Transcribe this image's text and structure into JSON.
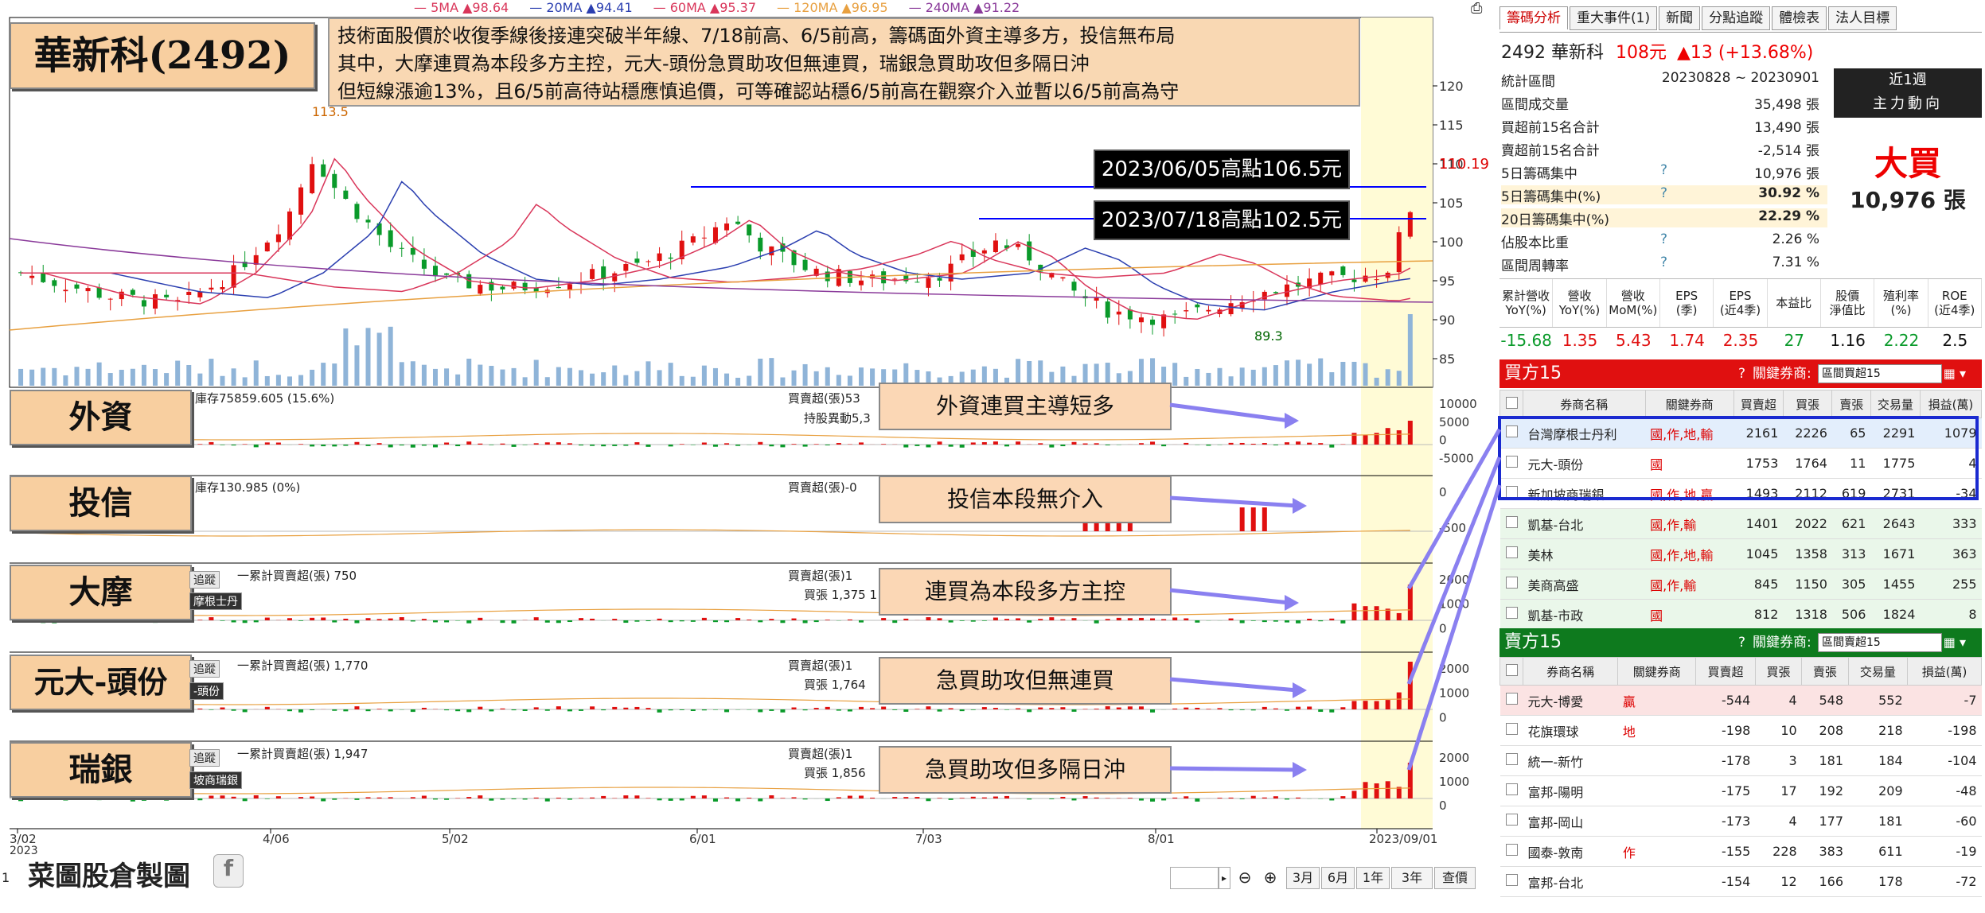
{
  "ma_legend": [
    {
      "label": "5MA ▲98.64",
      "color": "#d9365a"
    },
    {
      "label": "20MA ▲94.41",
      "color": "#2b3fb0"
    },
    {
      "label": "60MA ▲95.37",
      "color": "#d9365a"
    },
    {
      "label": "120MA ▲96.95",
      "color": "#e8a040"
    },
    {
      "label": "240MA ▲91.22",
      "color": "#8a3a9a"
    }
  ],
  "title": "華新科(2492)",
  "note_lines": [
    "技術面股價於收復季線後接連突破半年線、7/18前高、6/5前高，籌碼面外資主導多方，投信無布局",
    "其中，大摩連買為本段多方主控，元大-頭份急買助攻但無連買，瑞銀急買助攻但多隔日沖",
    "但短線漲逾13%，且6/5前高待站穩應慎追價，可等確認站穩6/5前高在觀察介入並暫以6/5前高為守"
  ],
  "price_high_label": "113.5",
  "price_low_label": "89.3",
  "current_price_label": "110.19",
  "price_box_1": "2023/06/05高點106.5元",
  "price_box_2": "2023/07/18高點102.5元",
  "y_ticks": [
    "120",
    "115",
    "110",
    "105",
    "100",
    "95",
    "90",
    "85"
  ],
  "panels": [
    {
      "name": "外資",
      "info1": "庫存75859.605 (15.6%)",
      "info2": "買賣超(張)53",
      "info3": "持股異動5,3",
      "callout": "外資連買主導短多",
      "ticks": [
        "10000",
        "5000",
        "0",
        "-5000"
      ]
    },
    {
      "name": "投信",
      "info1": "庫存130.985 (0%)",
      "info2": "買賣超(張)-0",
      "info3": "",
      "callout": "投信本段無介入",
      "ticks": [
        "0",
        "-500"
      ]
    },
    {
      "name": "大摩",
      "info1": "一累計買賣超(張) 750",
      "info2": "買賣超(張)1",
      "info3": "買張 1,375 1",
      "callout": "連買為本段多方主控",
      "ticks": [
        "2000",
        "1000",
        "0"
      ],
      "btn1": "追蹤",
      "btn2": "摩根士丹"
    },
    {
      "name": "元大-頭份",
      "info1": "一累計買賣超(張) 1,770",
      "info2": "買賣超(張)1",
      "info3": "買張 1,764",
      "callout": "急買助攻但無連買",
      "ticks": [
        "2000",
        "1000",
        "0"
      ],
      "btn1": "追蹤",
      "btn2": "-頭份"
    },
    {
      "name": "瑞銀",
      "info1": "一累計買賣超(張) 1,947",
      "info2": "買賣超(張)1",
      "info3": "買張 1,856",
      "callout": "急買助攻但多隔日沖",
      "ticks": [
        "2000",
        "1000",
        "0"
      ],
      "btn1": "追蹤",
      "btn2": "坡商瑞銀"
    }
  ],
  "x_labels": [
    "3/02",
    "4/06",
    "5/02",
    "6/01",
    "7/03",
    "8/01",
    "2023/09/01"
  ],
  "x_year": "2023",
  "footer_brand": "菜圖股倉製圖",
  "toolbar": [
    "3月",
    "6月",
    "1年",
    "3年",
    "查價"
  ],
  "page_indicator": "1",
  "right": {
    "tabs": [
      "籌碼分析",
      "重大事件(1)",
      "新聞",
      "分點追蹤",
      "體檢表",
      "法人目標"
    ],
    "stock": "2492 華新科",
    "price": "108元",
    "change": "▲13 (+13.68%)",
    "period_label": "近1週",
    "trend_label": "主力動向",
    "big_label": "大買",
    "big_value": "10,976 張",
    "stats": [
      {
        "label": "統計區間",
        "q": "",
        "value": "20230828 ~ 20230901"
      },
      {
        "label": "區間成交量",
        "q": "",
        "value": "35,498 張"
      },
      {
        "label": "買超前15名合計",
        "q": "",
        "value": "13,490 張"
      },
      {
        "label": "賣超前15名合計",
        "q": "",
        "value": "-2,514 張"
      },
      {
        "label": "5日籌碼集中",
        "q": "?",
        "value": "10,976 張"
      },
      {
        "label": "5日籌碼集中(%)",
        "q": "?",
        "value": "30.92 %"
      },
      {
        "label": "20日籌碼集中(%)",
        "q": "",
        "value": "22.29 %"
      },
      {
        "label": "佔股本比重",
        "q": "?",
        "value": "2.26 %"
      },
      {
        "label": "區間周轉率",
        "q": "?",
        "value": "7.31 %"
      }
    ],
    "fin_headers": [
      "累計營收\nYoY(%)",
      "營收\nYoY(%)",
      "營收\nMoM(%)",
      "EPS\n(季)",
      "EPS\n(近4季)",
      "本益比",
      "股價\n淨值比",
      "殖利率\n(%)",
      "ROE\n(近4季)"
    ],
    "fin_values": [
      "-15.68",
      "1.35",
      "5.43",
      "1.74",
      "2.35",
      "27",
      "1.16",
      "2.22",
      "2.5"
    ],
    "buy_title": "買方15",
    "sell_title": "賣方15",
    "key_broker_label": "關鍵券商:",
    "dropdown_buy": "區間買超15",
    "dropdown_sell": "區間賣超15",
    "table_headers": [
      "券商名稱",
      "關鍵券商",
      "買賣超",
      "買張",
      "賣張",
      "交易量",
      "損益(萬)"
    ],
    "buy_rows": [
      [
        "台灣摩根士丹利",
        "國,作,地,輸",
        "2161",
        "2226",
        "65",
        "2291",
        "1079"
      ],
      [
        "元大-頭份",
        "國",
        "1753",
        "1764",
        "11",
        "1775",
        "4"
      ],
      [
        "新加坡商瑞銀",
        "國,作,地,贏",
        "1493",
        "2112",
        "619",
        "2731",
        "-34"
      ],
      [
        "凱基-台北",
        "國,作,輸",
        "1401",
        "2022",
        "621",
        "2643",
        "333"
      ],
      [
        "美林",
        "國,作,地,輸",
        "1045",
        "1358",
        "313",
        "1671",
        "363"
      ],
      [
        "美商高盛",
        "國,作,輸",
        "845",
        "1150",
        "305",
        "1455",
        "255"
      ],
      [
        "凱基-市政",
        "國",
        "812",
        "1318",
        "506",
        "1824",
        "8"
      ]
    ],
    "sell_rows": [
      [
        "元大-博愛",
        "贏",
        "-544",
        "4",
        "548",
        "552",
        "-7"
      ],
      [
        "花旗環球",
        "地",
        "-198",
        "10",
        "208",
        "218",
        "-198"
      ],
      [
        "統一-新竹",
        "",
        "-178",
        "3",
        "181",
        "184",
        "-104"
      ],
      [
        "富邦-陽明",
        "",
        "-175",
        "17",
        "192",
        "209",
        "-48"
      ],
      [
        "富邦-岡山",
        "",
        "-173",
        "4",
        "177",
        "181",
        "-60"
      ],
      [
        "國泰-敦南",
        "作",
        "-155",
        "228",
        "383",
        "611",
        "-19"
      ],
      [
        "富邦-台北",
        "",
        "-154",
        "12",
        "166",
        "178",
        "-72"
      ]
    ]
  }
}
